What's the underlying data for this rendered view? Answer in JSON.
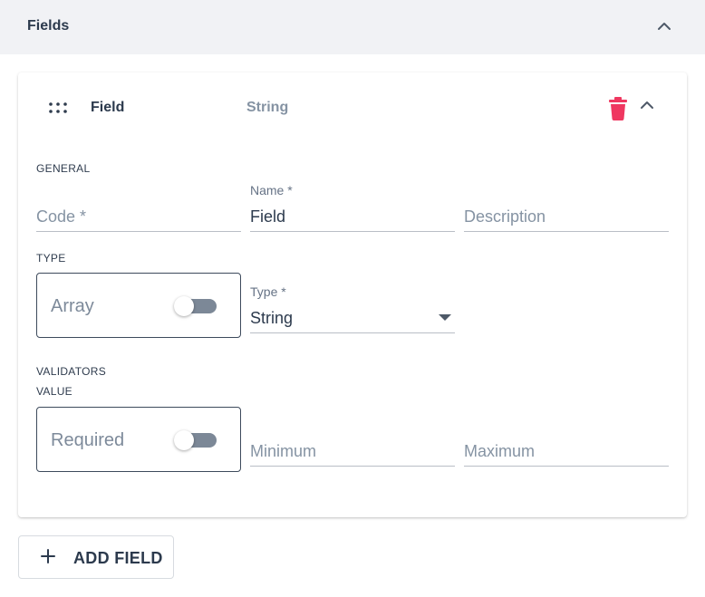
{
  "section": {
    "title": "Fields"
  },
  "field": {
    "title": "Field",
    "type_summary": "String",
    "general": {
      "heading": "GENERAL",
      "code": {
        "placeholder": "Code *",
        "value": ""
      },
      "name": {
        "label": "Name *",
        "value": "Field"
      },
      "description": {
        "placeholder": "Description",
        "value": ""
      }
    },
    "type_section": {
      "heading": "TYPE",
      "array": {
        "label": "Array",
        "on": false
      },
      "type_select": {
        "label": "Type *",
        "value": "String"
      }
    },
    "validators": {
      "heading": "VALIDATORS",
      "subheading": "VALUE",
      "required": {
        "label": "Required",
        "on": false
      },
      "minimum": {
        "placeholder": "Minimum",
        "value": ""
      },
      "maximum": {
        "placeholder": "Maximum",
        "value": ""
      }
    }
  },
  "add_field_label": "ADD FIELD",
  "colors": {
    "delete": "#ef3760",
    "text_primary": "#2c3a4d",
    "text_muted": "#8593a3",
    "header_bg": "#f1f2f5"
  },
  "icons": [
    "chevron-up-icon",
    "drag-handle-icon",
    "trash-icon",
    "plus-icon"
  ]
}
